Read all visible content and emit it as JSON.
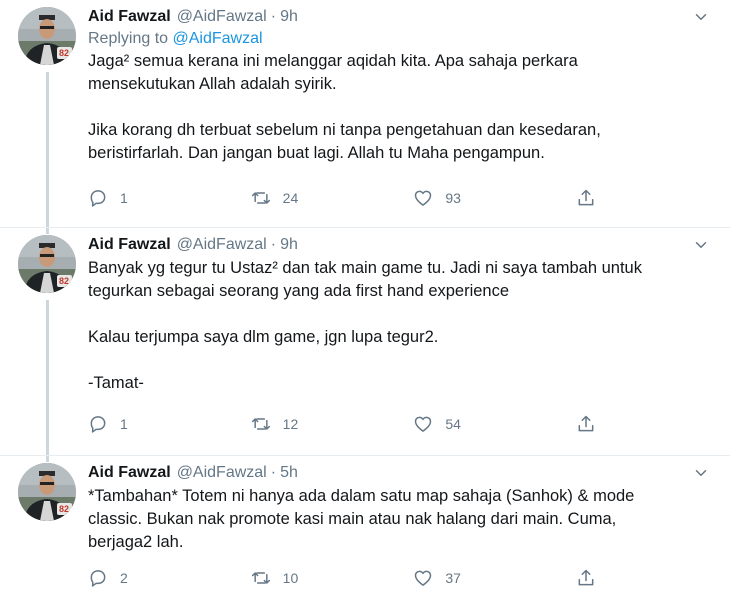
{
  "tweets": [
    {
      "name": "Aid Fawzal",
      "handle": "@AidFawzal",
      "separator": "·",
      "time": "9h",
      "replying_prefix": "Replying to ",
      "replying_to": "@AidFawzal",
      "lines": [
        "Jaga² semua kerana ini melanggar aqidah kita. Apa sahaja perkara",
        "mensekutukan Allah adalah syirik.",
        "",
        "Jika korang dh terbuat sebelum ni tanpa pengetahuan dan kesedaran,",
        "beristirfarlah. Dan jangan buat lagi. Allah tu Maha pengampun."
      ],
      "replies": "1",
      "retweets": "24",
      "likes": "93"
    },
    {
      "name": "Aid Fawzal",
      "handle": "@AidFawzal",
      "separator": "·",
      "time": "9h",
      "lines": [
        "Banyak yg tegur tu Ustaz² dan tak main game tu. Jadi ni saya tambah untuk",
        "tegurkan sebagai seorang yang ada first hand experience",
        "",
        "Kalau terjumpa saya dlm game, jgn lupa tegur2.",
        "",
        "-Tamat-"
      ],
      "replies": "1",
      "retweets": "12",
      "likes": "54"
    },
    {
      "name": "Aid Fawzal",
      "handle": "@AidFawzal",
      "separator": "·",
      "time": "5h",
      "lines": [
        "*Tambahan* Totem ni hanya ada dalam satu map sahaja (Sanhok) & mode",
        "classic. Bukan nak promote kasi main atau nak halang dari main. Cuma,",
        "berjaga2 lah."
      ],
      "replies": "2",
      "retweets": "10",
      "likes": "37"
    }
  ],
  "avatar_badge": "82",
  "icons": {
    "reply": "reply-icon",
    "retweet": "retweet-icon",
    "like": "heart-icon",
    "share": "share-icon",
    "menu": "chevron-down-icon"
  },
  "colors": {
    "text": "#14171a",
    "secondary": "#657786",
    "link": "#1b95e0",
    "thread_line": "#ccd6dd"
  }
}
